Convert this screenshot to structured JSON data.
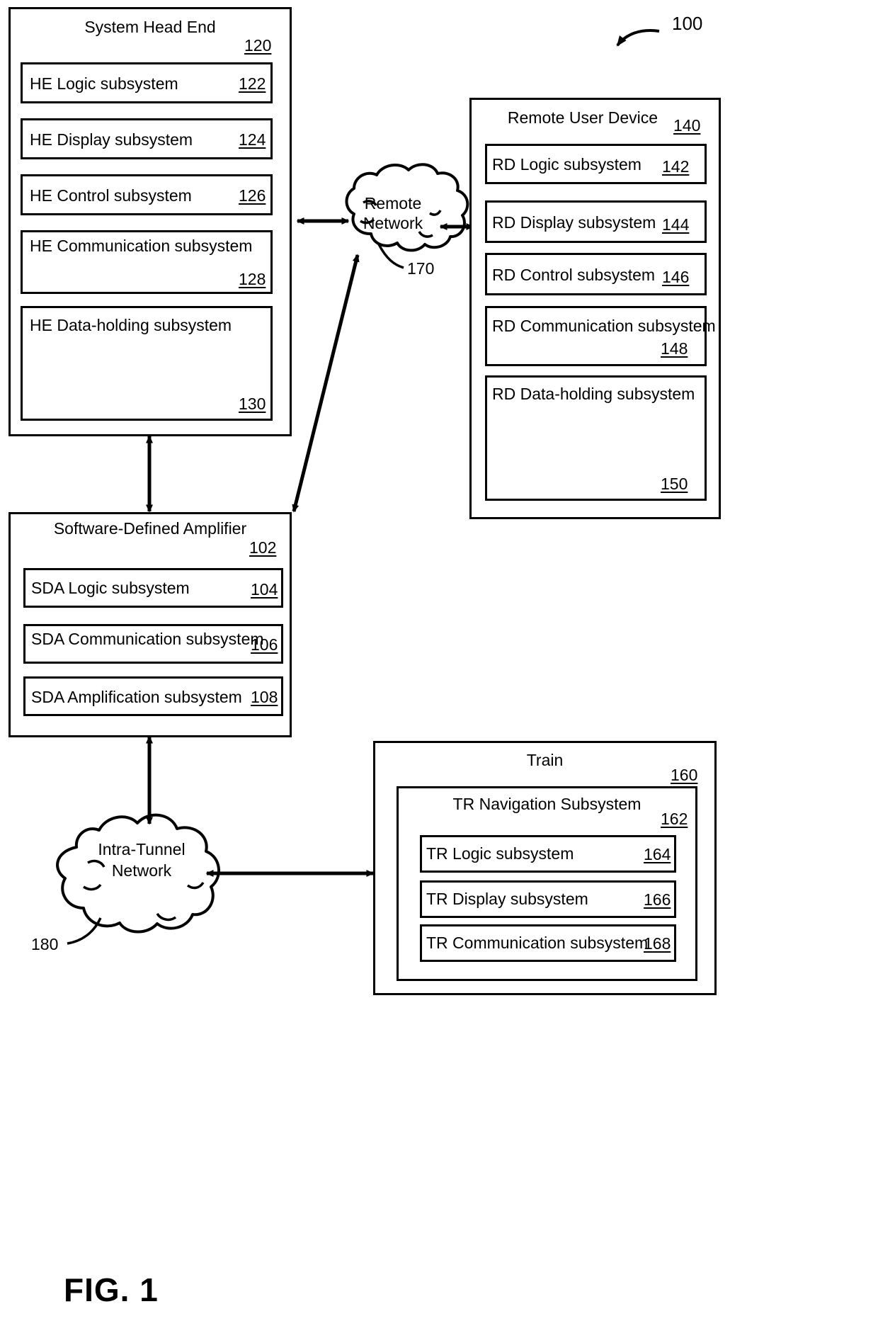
{
  "figure": {
    "caption": "FIG. 1",
    "system_ref": "100"
  },
  "head_end": {
    "title": "System Head End",
    "ref": "120",
    "items": [
      {
        "label": "HE Logic subsystem",
        "ref": "122"
      },
      {
        "label": "HE Display subsystem",
        "ref": "124"
      },
      {
        "label": "HE Control subsystem",
        "ref": "126"
      },
      {
        "label": "HE Communication subsystem",
        "ref": "128"
      },
      {
        "label": "HE Data-holding subsystem",
        "ref": "130",
        "icon": "database-cylinders-icon"
      }
    ]
  },
  "remote_user_device": {
    "title": "Remote User Device",
    "ref": "140",
    "items": [
      {
        "label": "RD Logic subsystem",
        "ref": "142"
      },
      {
        "label": "RD Display subsystem",
        "ref": "144"
      },
      {
        "label": "RD Control subsystem",
        "ref": "146"
      },
      {
        "label": "RD Communication subsystem",
        "ref": "148"
      },
      {
        "label": "RD Data-holding subsystem",
        "ref": "150",
        "icon": "database-cylinders-icon"
      }
    ]
  },
  "software_defined_amplifier": {
    "title": "Software-Defined Amplifier",
    "ref": "102",
    "items": [
      {
        "label": "SDA Logic subsystem",
        "ref": "104",
        "icon": "rack-device-icon"
      },
      {
        "label": "SDA Communication subsystem",
        "ref": "106"
      },
      {
        "label": "SDA Amplification subsystem",
        "ref": "108"
      }
    ]
  },
  "train": {
    "title": "Train",
    "ref": "160",
    "navigation": {
      "title": "TR Navigation Subsystem",
      "ref": "162",
      "items": [
        {
          "label": "TR Logic subsystem",
          "ref": "164"
        },
        {
          "label": "TR Display subsystem",
          "ref": "166"
        },
        {
          "label": "TR Communication subsystem",
          "ref": "168"
        }
      ]
    }
  },
  "clouds": [
    {
      "line1": "Remote",
      "line2": "Network",
      "ref": "170",
      "name": "remote-network-cloud"
    },
    {
      "line1": "Intra-Tunnel",
      "line2": "Network",
      "ref": "180",
      "name": "intra-tunnel-network-cloud"
    }
  ],
  "colors": {
    "stroke": "#000000",
    "background": "#ffffff"
  }
}
